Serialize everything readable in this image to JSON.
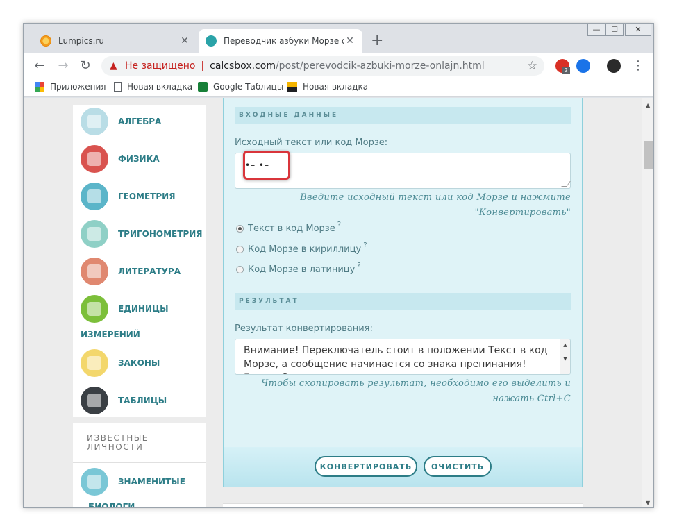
{
  "window": {
    "minimize": "—",
    "maximize": "☐",
    "close": "✕"
  },
  "tabs": [
    {
      "title": "Lumpics.ru",
      "close": "✕"
    },
    {
      "title": "Переводчик азбуки Морзе онла",
      "close": "✕"
    }
  ],
  "new_tab": "+",
  "toolbar": {
    "back": "←",
    "forward": "→",
    "reload": "↻",
    "warning_icon": "▲",
    "not_secure": "Не защищено",
    "separator": "|",
    "url_host": "calcsbox.com",
    "url_path": "/post/perevodcik-azbuki-morze-onlajn.html",
    "star": "☆",
    "ext_badge": "2",
    "menu": "⋮"
  },
  "bookmarks": [
    {
      "label": "Приложения",
      "icon": "apps-grid-icon"
    },
    {
      "label": "Новая вкладка",
      "icon": "page-icon"
    },
    {
      "label": "Google Таблицы",
      "icon": "sheets-icon"
    },
    {
      "label": "Новая вкладка",
      "icon": "image-icon"
    }
  ],
  "sidebar": {
    "items": [
      {
        "label": "АЛГЕБРА",
        "color": "#b9dde6"
      },
      {
        "label": "ФИЗИКА",
        "color": "#d9534f"
      },
      {
        "label": "ГЕОМЕТРИЯ",
        "color": "#5bb5c9"
      },
      {
        "label": "ТРИГОНОМЕТРИЯ",
        "color": "#8fd0c6"
      },
      {
        "label": "ЛИТЕРАТУРА",
        "color": "#e08870"
      },
      {
        "label": "ЕДИНИЦЫ",
        "label2": "ИЗМЕРЕНИЙ",
        "color": "#7cbf3a"
      },
      {
        "label": "ЗАКОНЫ",
        "color": "#f3d76c"
      },
      {
        "label": "ТАБЛИЦЫ",
        "color": "#3a3f44"
      }
    ],
    "famous": {
      "title_line1": "ИЗВЕСТНЫЕ",
      "title_line2": "ЛИЧНОСТИ",
      "item": "ЗНАМЕНИТЫЕ",
      "item_color": "#7ac7d6",
      "cut_text": "БИОЛОГИ"
    }
  },
  "form": {
    "input_section": "ВХОДНЫЕ ДАННЫЕ",
    "input_label": "Исходный текст или код Морзе:",
    "input_value": "•– •–",
    "input_hint_1": "Введите исходный текст или код Морзе и нажмите",
    "input_hint_2": "\"Конвертировать\"",
    "options": [
      {
        "label": "Текст в код Морзе",
        "checked": true
      },
      {
        "label": "Код Морзе в кириллицу",
        "checked": false
      },
      {
        "label": "Код Морзе в латиницу",
        "checked": false
      }
    ],
    "question_mark": "?",
    "result_section": "РЕЗУЛЬТАТ",
    "result_label": "Результат конвертирования:",
    "result_text": "Внимание! Переключатель стоит в положении Текст в код Морзе, а сообщение начинается со знака препинания! Если всё",
    "result_hint_1": "Чтобы скопировать результат, необходимо его выделить и",
    "result_hint_2": "нажать Ctrl+C",
    "convert_button": "КОНВЕРТИРОВАТЬ",
    "clear_button": "ОЧИСТИТЬ"
  },
  "colors": {
    "accent": "#2d7d87",
    "highlight": "#d9353b",
    "panel": "#dff3f7"
  }
}
